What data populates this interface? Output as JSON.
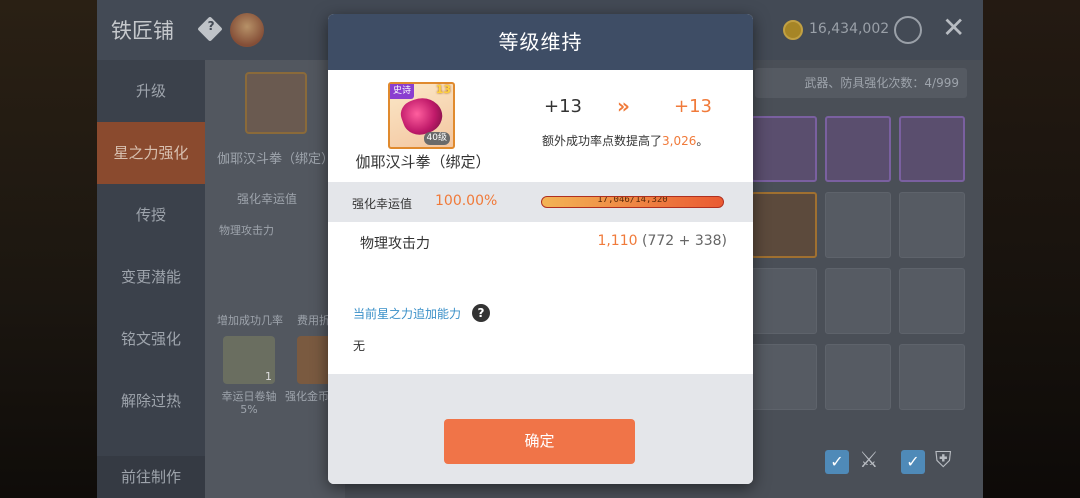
{
  "base": {
    "title": "铁匠铺",
    "gold": "16,434,002",
    "sidebar": [
      "升级",
      "星之力强化",
      "传授",
      "变更潜能",
      "铭文强化",
      "解除过热"
    ],
    "go_make": "前往制作",
    "item_name": "伽耶汉斗拳（绑定）",
    "luck_label": "强化幸运值",
    "attack_label": "物理攻击力",
    "add_rate_label": "增加成功几率",
    "cost_label": "费用折",
    "scroll_name": "幸运日卷轴 5%",
    "coupon_name": "强化金币券",
    "scroll_count": "1",
    "upgrade_count": "武器、防具强化次数：4/999"
  },
  "modal": {
    "title": "等级维持",
    "item": {
      "rarity": "史诗",
      "stars": "13",
      "level": "40级",
      "name": "伽耶汉斗拳（绑定）"
    },
    "star_from": "+13",
    "star_arrow": "»",
    "star_to": "+13",
    "extra_prefix": "额外成功率点数提高了",
    "extra_value": "3,026",
    "extra_suffix": "。",
    "luck_label": "强化幸运值",
    "luck_pct": "100.00%",
    "luck_progress": 1.0,
    "luck_bar_text": "17,046/14,320",
    "attack_label": "物理攻击力",
    "attack_total": "1,110",
    "attack_detail": "(772 + 338)",
    "bonus_label": "当前星之力追加能力",
    "help": "?",
    "bonus_value": "无",
    "confirm": "确定"
  }
}
